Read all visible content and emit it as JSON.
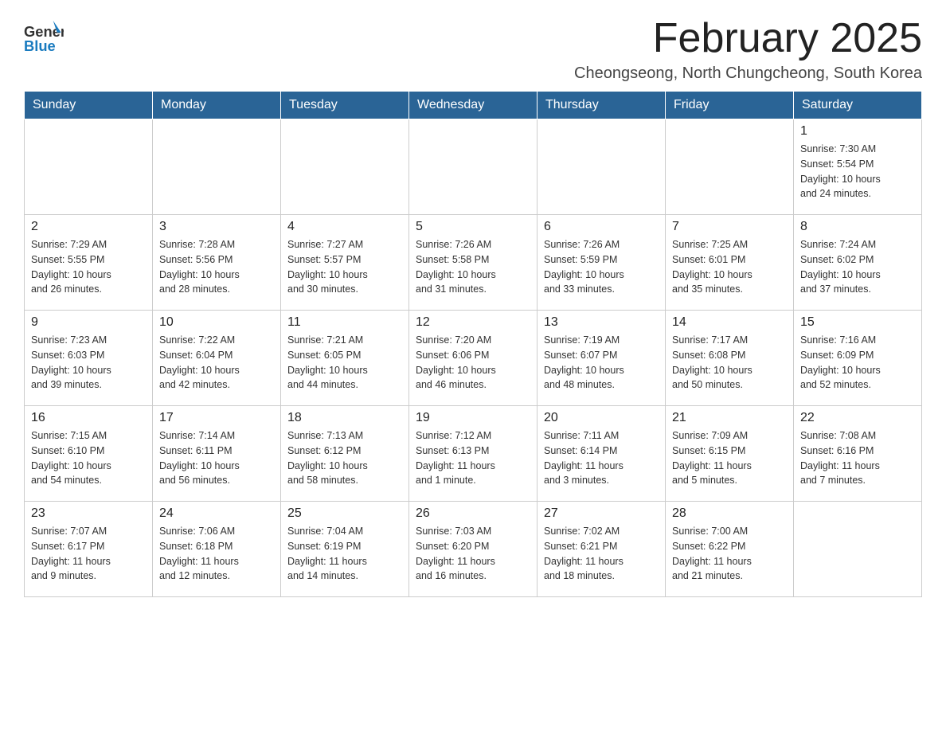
{
  "header": {
    "logo_general": "General",
    "logo_blue": "Blue",
    "month_title": "February 2025",
    "location": "Cheongseong, North Chungcheong, South Korea"
  },
  "days_of_week": [
    "Sunday",
    "Monday",
    "Tuesday",
    "Wednesday",
    "Thursday",
    "Friday",
    "Saturday"
  ],
  "weeks": [
    [
      {
        "day": "",
        "info": ""
      },
      {
        "day": "",
        "info": ""
      },
      {
        "day": "",
        "info": ""
      },
      {
        "day": "",
        "info": ""
      },
      {
        "day": "",
        "info": ""
      },
      {
        "day": "",
        "info": ""
      },
      {
        "day": "1",
        "info": "Sunrise: 7:30 AM\nSunset: 5:54 PM\nDaylight: 10 hours\nand 24 minutes."
      }
    ],
    [
      {
        "day": "2",
        "info": "Sunrise: 7:29 AM\nSunset: 5:55 PM\nDaylight: 10 hours\nand 26 minutes."
      },
      {
        "day": "3",
        "info": "Sunrise: 7:28 AM\nSunset: 5:56 PM\nDaylight: 10 hours\nand 28 minutes."
      },
      {
        "day": "4",
        "info": "Sunrise: 7:27 AM\nSunset: 5:57 PM\nDaylight: 10 hours\nand 30 minutes."
      },
      {
        "day": "5",
        "info": "Sunrise: 7:26 AM\nSunset: 5:58 PM\nDaylight: 10 hours\nand 31 minutes."
      },
      {
        "day": "6",
        "info": "Sunrise: 7:26 AM\nSunset: 5:59 PM\nDaylight: 10 hours\nand 33 minutes."
      },
      {
        "day": "7",
        "info": "Sunrise: 7:25 AM\nSunset: 6:01 PM\nDaylight: 10 hours\nand 35 minutes."
      },
      {
        "day": "8",
        "info": "Sunrise: 7:24 AM\nSunset: 6:02 PM\nDaylight: 10 hours\nand 37 minutes."
      }
    ],
    [
      {
        "day": "9",
        "info": "Sunrise: 7:23 AM\nSunset: 6:03 PM\nDaylight: 10 hours\nand 39 minutes."
      },
      {
        "day": "10",
        "info": "Sunrise: 7:22 AM\nSunset: 6:04 PM\nDaylight: 10 hours\nand 42 minutes."
      },
      {
        "day": "11",
        "info": "Sunrise: 7:21 AM\nSunset: 6:05 PM\nDaylight: 10 hours\nand 44 minutes."
      },
      {
        "day": "12",
        "info": "Sunrise: 7:20 AM\nSunset: 6:06 PM\nDaylight: 10 hours\nand 46 minutes."
      },
      {
        "day": "13",
        "info": "Sunrise: 7:19 AM\nSunset: 6:07 PM\nDaylight: 10 hours\nand 48 minutes."
      },
      {
        "day": "14",
        "info": "Sunrise: 7:17 AM\nSunset: 6:08 PM\nDaylight: 10 hours\nand 50 minutes."
      },
      {
        "day": "15",
        "info": "Sunrise: 7:16 AM\nSunset: 6:09 PM\nDaylight: 10 hours\nand 52 minutes."
      }
    ],
    [
      {
        "day": "16",
        "info": "Sunrise: 7:15 AM\nSunset: 6:10 PM\nDaylight: 10 hours\nand 54 minutes."
      },
      {
        "day": "17",
        "info": "Sunrise: 7:14 AM\nSunset: 6:11 PM\nDaylight: 10 hours\nand 56 minutes."
      },
      {
        "day": "18",
        "info": "Sunrise: 7:13 AM\nSunset: 6:12 PM\nDaylight: 10 hours\nand 58 minutes."
      },
      {
        "day": "19",
        "info": "Sunrise: 7:12 AM\nSunset: 6:13 PM\nDaylight: 11 hours\nand 1 minute."
      },
      {
        "day": "20",
        "info": "Sunrise: 7:11 AM\nSunset: 6:14 PM\nDaylight: 11 hours\nand 3 minutes."
      },
      {
        "day": "21",
        "info": "Sunrise: 7:09 AM\nSunset: 6:15 PM\nDaylight: 11 hours\nand 5 minutes."
      },
      {
        "day": "22",
        "info": "Sunrise: 7:08 AM\nSunset: 6:16 PM\nDaylight: 11 hours\nand 7 minutes."
      }
    ],
    [
      {
        "day": "23",
        "info": "Sunrise: 7:07 AM\nSunset: 6:17 PM\nDaylight: 11 hours\nand 9 minutes."
      },
      {
        "day": "24",
        "info": "Sunrise: 7:06 AM\nSunset: 6:18 PM\nDaylight: 11 hours\nand 12 minutes."
      },
      {
        "day": "25",
        "info": "Sunrise: 7:04 AM\nSunset: 6:19 PM\nDaylight: 11 hours\nand 14 minutes."
      },
      {
        "day": "26",
        "info": "Sunrise: 7:03 AM\nSunset: 6:20 PM\nDaylight: 11 hours\nand 16 minutes."
      },
      {
        "day": "27",
        "info": "Sunrise: 7:02 AM\nSunset: 6:21 PM\nDaylight: 11 hours\nand 18 minutes."
      },
      {
        "day": "28",
        "info": "Sunrise: 7:00 AM\nSunset: 6:22 PM\nDaylight: 11 hours\nand 21 minutes."
      },
      {
        "day": "",
        "info": ""
      }
    ]
  ]
}
